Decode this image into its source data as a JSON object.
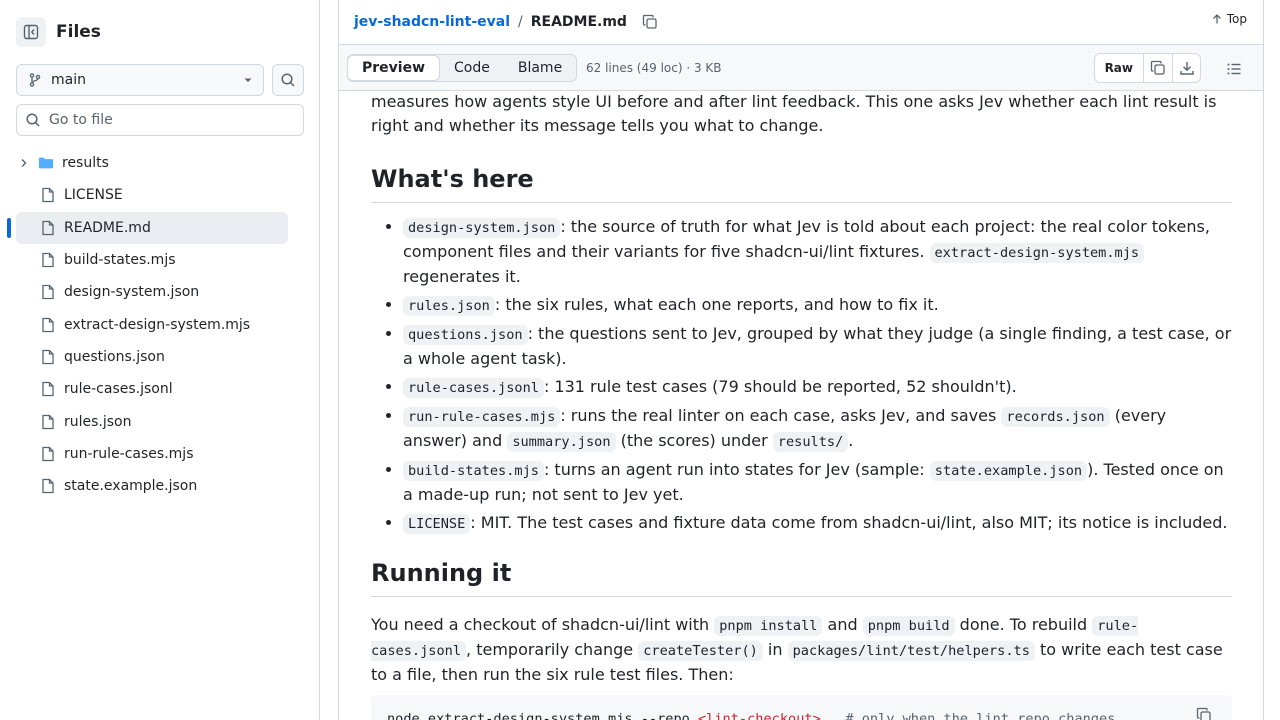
{
  "sidebar": {
    "title": "Files",
    "branch": "main",
    "goto_placeholder": "Go to file",
    "items": [
      {
        "label": "results",
        "type": "folder"
      },
      {
        "label": "LICENSE",
        "type": "file"
      },
      {
        "label": "README.md",
        "type": "file",
        "active": true
      },
      {
        "label": "build-states.mjs",
        "type": "file"
      },
      {
        "label": "design-system.json",
        "type": "file"
      },
      {
        "label": "extract-design-system.mjs",
        "type": "file"
      },
      {
        "label": "questions.json",
        "type": "file"
      },
      {
        "label": "rule-cases.jsonl",
        "type": "file"
      },
      {
        "label": "rules.json",
        "type": "file"
      },
      {
        "label": "run-rule-cases.mjs",
        "type": "file"
      },
      {
        "label": "state.example.json",
        "type": "file"
      }
    ]
  },
  "header": {
    "repo": "jev-shadcn-lint-eval",
    "separator": "/",
    "file": "README.md",
    "top_label": "Top"
  },
  "toolbar": {
    "tabs": [
      "Preview",
      "Code",
      "Blame"
    ],
    "active_tab": "Preview",
    "file_info": "62 lines (49 loc) · 3 KB",
    "raw_label": "Raw"
  },
  "article": {
    "intro": "measures how agents style UI before and after lint feedback. This one asks Jev whether each lint result is right and whether its message tells you what to change.",
    "h_whats_here": "What's here",
    "bullets": {
      "b1_code": "design-system.json",
      "b1_text": ": the source of truth for what Jev is told about each project: the real color tokens, component files and their variants for five shadcn-ui/lint fixtures. ",
      "b1_code2": "extract-design-system.mjs",
      "b1_text2": " regenerates it.",
      "b2_code": "rules.json",
      "b2_text": ": the six rules, what each one reports, and how to fix it.",
      "b3_code": "questions.json",
      "b3_text": ": the questions sent to Jev, grouped by what they judge (a single finding, a test case, or a whole agent task).",
      "b4_code": "rule-cases.jsonl",
      "b4_text": ": 131 rule test cases (79 should be reported, 52 shouldn't).",
      "b5_code": "run-rule-cases.mjs",
      "b5_text": ": runs the real linter on each case, asks Jev, and saves ",
      "b5_code2": "records.json",
      "b5_text2": " (every answer) and ",
      "b5_code3": "summary.json",
      "b5_text3": " (the scores) under ",
      "b5_code4": "results/",
      "b5_text4": ".",
      "b6_code": "build-states.mjs",
      "b6_text": ": turns an agent run into states for Jev (sample: ",
      "b6_code2": "state.example.json",
      "b6_text2": "). Tested once on a made-up run; not sent to Jev yet.",
      "b7_code": "LICENSE",
      "b7_text": ": MIT. The test cases and fixture data come from shadcn-ui/lint, also MIT; its notice is included."
    },
    "h_running": "Running it",
    "run_p": {
      "t1": "You need a checkout of shadcn-ui/lint with ",
      "c1": "pnpm install",
      "t2": " and ",
      "c2": "pnpm build",
      "t3": " done. To rebuild ",
      "c3": "rule-cases.jsonl",
      "t4": ", temporarily change ",
      "c4": "createTester()",
      "t5": " in ",
      "c5": "packages/lint/test/helpers.ts",
      "t6": " to write each test case to a file, then run the six rule test files. Then:"
    },
    "code": {
      "cmd": "node extract-design-system.mjs --repo ",
      "arg": "<lint-checkout>",
      "comment": "# only when the lint repo changes"
    }
  }
}
